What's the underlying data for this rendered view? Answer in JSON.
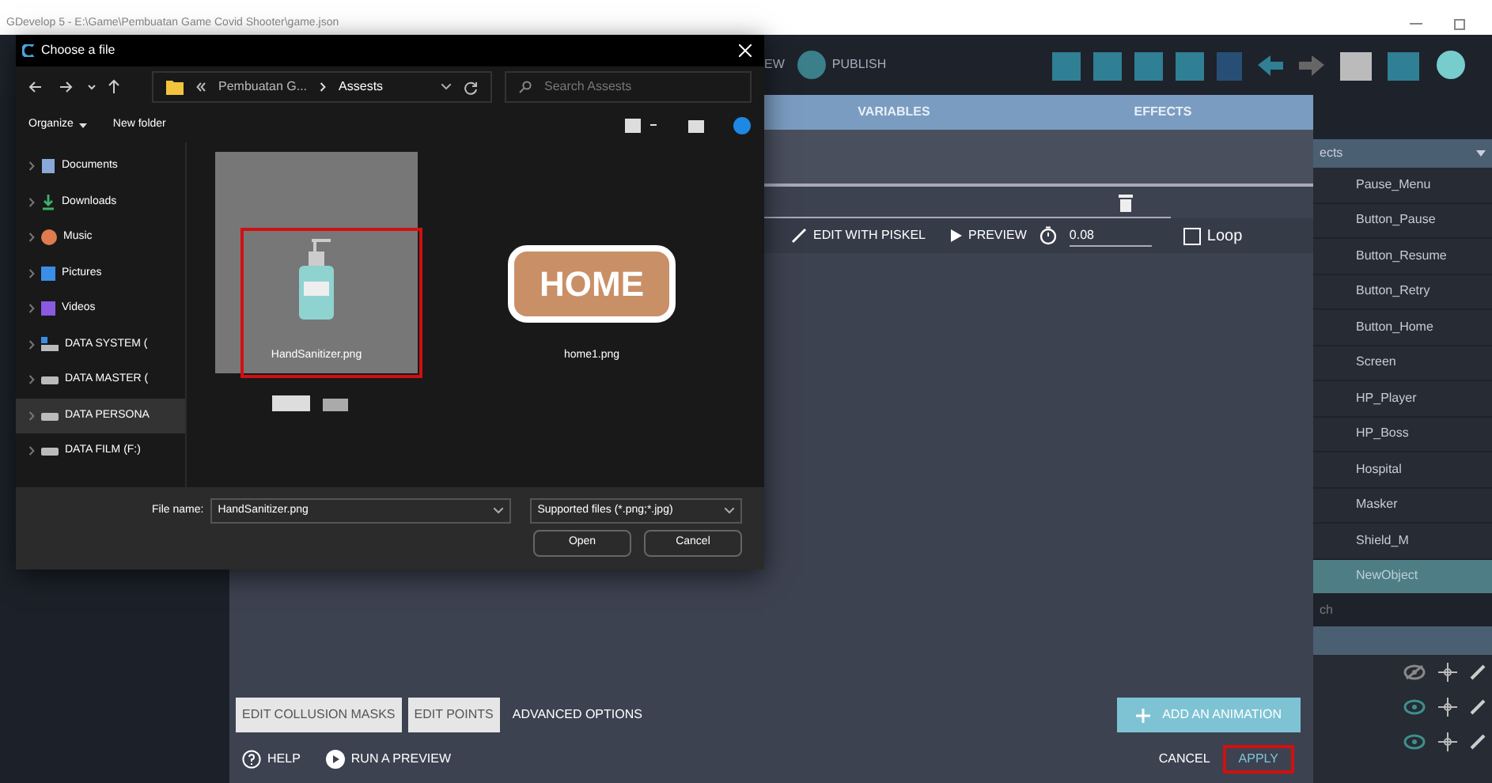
{
  "app_window": {
    "title": "GDevelop 5 - E:\\Game\\Pembuatan Game Covid Shooter\\game.json"
  },
  "toolbar": {
    "preview_fragment": "EW",
    "publish": "PUBLISH"
  },
  "object_editor": {
    "tabs": [
      {
        "label": "VARIABLES",
        "selected": false
      },
      {
        "label": "EFFECTS",
        "selected": false
      }
    ],
    "animation": {
      "edit_button": "EDIT WITH PISKEL",
      "preview_button": "PREVIEW",
      "timing": "0.08",
      "loop": {
        "label": "Loop",
        "checked": false
      }
    },
    "bottom_buttons": [
      {
        "label": "EDIT COLLUSION MASKS",
        "kind": "boxed"
      },
      {
        "label": "EDIT POINTS",
        "kind": "boxed"
      },
      {
        "label": "ADVANCED OPTIONS",
        "kind": "flat"
      }
    ],
    "add_button": "ADD AN ANIMATION",
    "footer": {
      "help": "HELP",
      "run_preview": "RUN A PREVIEW",
      "cancel": "CANCEL",
      "apply": {
        "label": "APPLY",
        "highlighted": true
      }
    }
  },
  "objects_panel": {
    "title": "ects",
    "items": [
      {
        "name": "Pause_Menu",
        "selected": false
      },
      {
        "name": "Button_Pause",
        "selected": false
      },
      {
        "name": "Button_Resume",
        "selected": false
      },
      {
        "name": "Button_Retry",
        "selected": false
      },
      {
        "name": "Button_Home",
        "selected": false
      },
      {
        "name": "Screen",
        "selected": false
      },
      {
        "name": "HP_Player",
        "selected": false
      },
      {
        "name": "HP_Boss",
        "selected": false
      },
      {
        "name": "Hospital",
        "selected": false
      },
      {
        "name": "Masker",
        "selected": false
      },
      {
        "name": "Shield_M",
        "selected": false
      },
      {
        "name": "NewObject",
        "selected": true
      }
    ],
    "search_placeholder": "ch",
    "layers": [
      {
        "visible": false
      },
      {
        "visible": true
      },
      {
        "visible": true
      }
    ]
  },
  "file_dialog": {
    "title": "Choose a file",
    "breadcrumb": [
      "Pembuatan G...",
      "Assests"
    ],
    "search_placeholder": "Search Assests",
    "organize": "Organize",
    "new_folder": "New folder",
    "sidebar": [
      {
        "label": "Documents",
        "kind": "documents",
        "selected": false
      },
      {
        "label": "Downloads",
        "kind": "downloads",
        "selected": false
      },
      {
        "label": "Music",
        "kind": "music",
        "selected": false
      },
      {
        "label": "Pictures",
        "kind": "pictures",
        "selected": false
      },
      {
        "label": "Videos",
        "kind": "videos",
        "selected": false
      },
      {
        "label": "DATA SYSTEM (",
        "kind": "system-drive",
        "selected": false
      },
      {
        "label": "DATA MASTER (",
        "kind": "drive",
        "selected": false
      },
      {
        "label": "DATA PERSONA",
        "kind": "drive",
        "selected": true
      },
      {
        "label": "DATA FILM (F:)",
        "kind": "drive",
        "selected": false
      }
    ],
    "files": [
      {
        "name": "HandSanitizer.png",
        "kind": "sanitizer",
        "selected": true,
        "highlighted": true
      },
      {
        "name": "home1.png",
        "kind": "home",
        "selected": false,
        "highlighted": false,
        "thumbnail_text": "HOME"
      }
    ],
    "file_name_label": "File name:",
    "file_name": "HandSanitizer.png",
    "filter": "Supported files (*.png;*.jpg)",
    "open": "Open",
    "cancel": "Cancel"
  }
}
